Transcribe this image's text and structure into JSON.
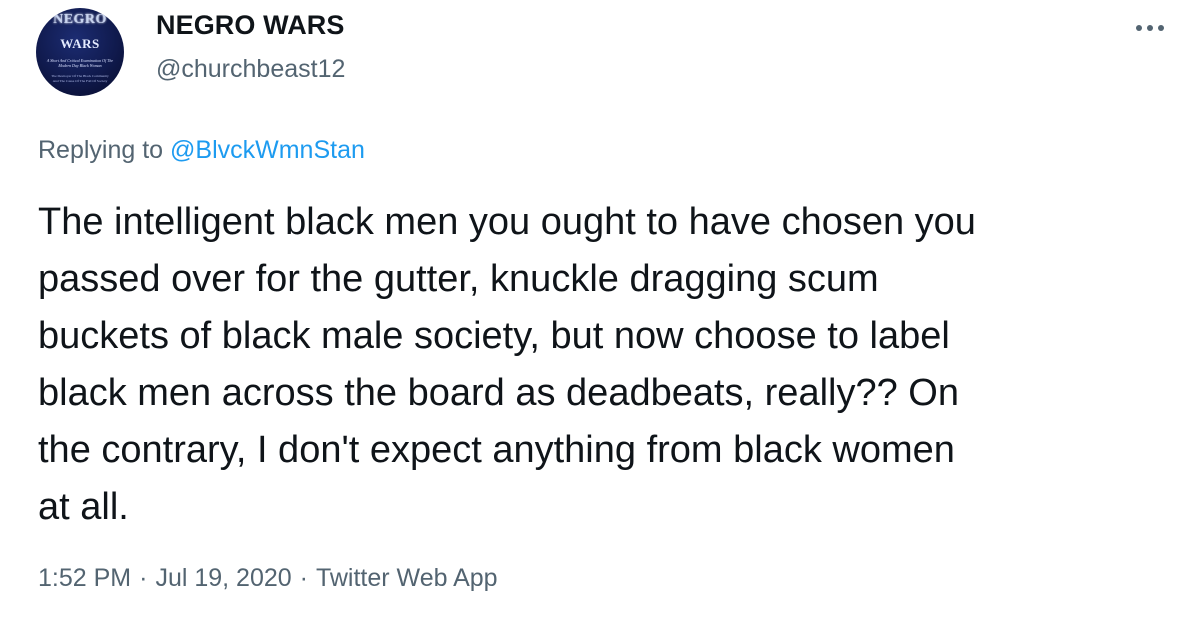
{
  "author": {
    "display_name": "NEGRO WARS",
    "handle": "@churchbeast12",
    "avatar": {
      "title_line_1": "NEGRO",
      "title_line_2": "WARS",
      "subtitle": "A Short And Critical Examination Of The Modern Day Black Woman",
      "caption": "The Destroyer Of The Black Community And The Cause Of The Fall Of Society"
    }
  },
  "more_icon": "ellipsis-icon",
  "reply": {
    "prefix": "Replying to",
    "mention": "@BlvckWmnStan"
  },
  "tweet": {
    "line_1": "The intelligent black men you ought to have chosen you",
    "line_2": "passed over for the gutter, knuckle dragging scum",
    "line_3": "buckets of black male society, but now choose to label",
    "line_4": "black men across the board as deadbeats, really?? On",
    "line_5": "the contrary, I don't expect anything from black women",
    "line_6": "at all."
  },
  "meta": {
    "time": "1:52 PM",
    "separator": "·",
    "date": "Jul 19, 2020",
    "source": "Twitter Web App"
  },
  "colors": {
    "text": "#0f1419",
    "secondary": "#536471",
    "link": "#1d9bf0"
  }
}
